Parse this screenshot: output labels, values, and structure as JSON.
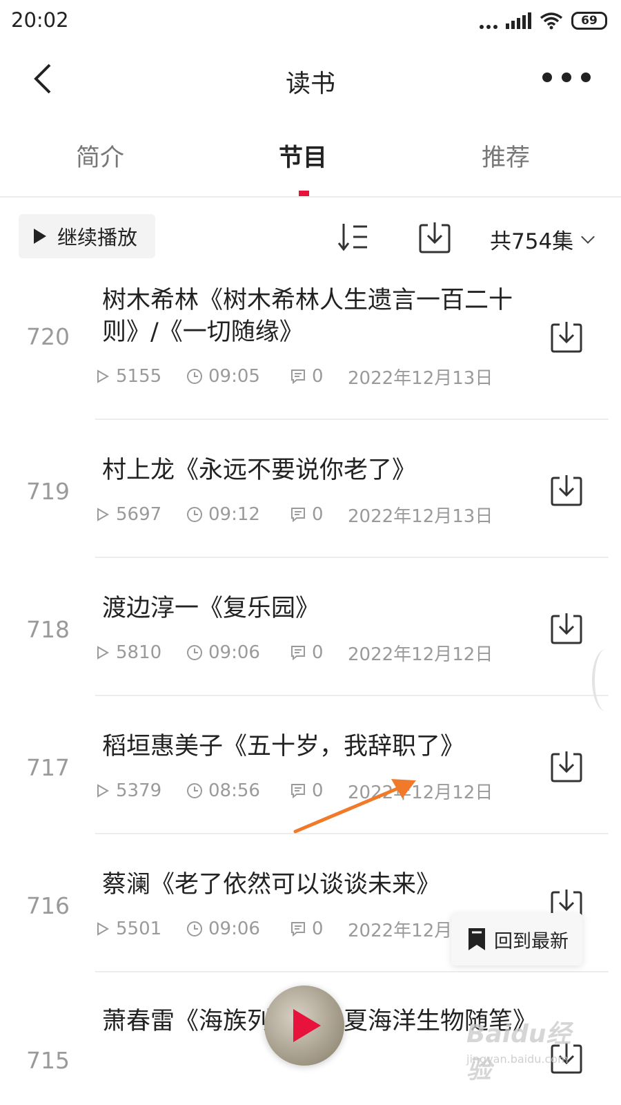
{
  "status_bar": {
    "time": "20:02",
    "battery": "69"
  },
  "header": {
    "title": "读书"
  },
  "tabs": [
    {
      "label": "简介",
      "active": false
    },
    {
      "label": "节目",
      "active": true
    },
    {
      "label": "推荐",
      "active": false
    }
  ],
  "toolbar": {
    "continue_label": "继续播放",
    "episode_count": "共754集"
  },
  "episodes": [
    {
      "number": "720",
      "title": "树木希林《树木希林人生遗言一百二十则》/《一切随缘》",
      "plays": "5155",
      "duration": "09:05",
      "comments": "0",
      "date": "2022年12月13日"
    },
    {
      "number": "719",
      "title": "村上龙《永远不要说你老了》",
      "plays": "5697",
      "duration": "09:12",
      "comments": "0",
      "date": "2022年12月13日"
    },
    {
      "number": "718",
      "title": "渡边淳一《复乐园》",
      "plays": "5810",
      "duration": "09:06",
      "comments": "0",
      "date": "2022年12月12日"
    },
    {
      "number": "717",
      "title": "稻垣惠美子《五十岁，我辞职了》",
      "plays": "5379",
      "duration": "08:56",
      "comments": "0",
      "date": "2022年12月12日"
    },
    {
      "number": "716",
      "title": "蔡澜《老了依然可以谈谈未来》",
      "plays": "5501",
      "duration": "09:06",
      "comments": "0",
      "date": "2022年12月09日"
    },
    {
      "number": "715",
      "title": "萧春雷《海族列传：华夏海洋生物随笔》"
    }
  ],
  "floating": {
    "back_to_latest": "回到最新"
  },
  "watermark": {
    "text": "Baidu经验",
    "url": "jingyan.baidu.com"
  },
  "colors": {
    "accent": "#e8133c",
    "annotation_arrow": "#f07a2a"
  }
}
